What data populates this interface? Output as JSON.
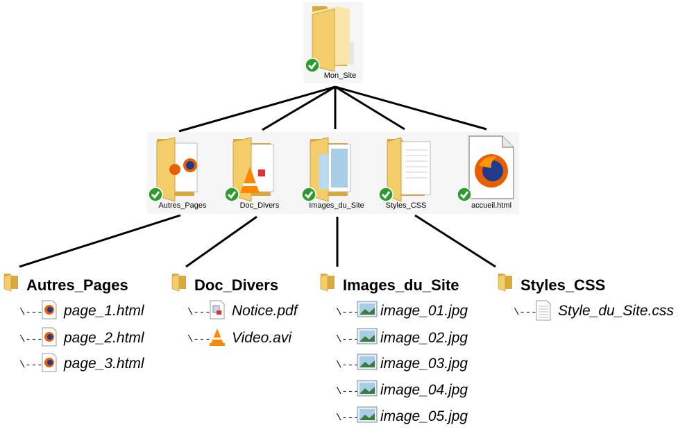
{
  "colors": {
    "folder": "#f2cd6a",
    "folder_dark": "#d9a93b",
    "check": "#2e9b2e",
    "line": "#000000",
    "tile_bg": "#f5f5f5"
  },
  "root": {
    "label": "Mon_Site",
    "icon": "folder-icon",
    "synced": true
  },
  "children": [
    {
      "label": "Autres_Pages",
      "icon": "folder-icon",
      "synced": true
    },
    {
      "label": "Doc_Divers",
      "icon": "folder-icon",
      "synced": true
    },
    {
      "label": "Images_du_Site",
      "icon": "folder-icon",
      "synced": true
    },
    {
      "label": "Styles_CSS",
      "icon": "folder-icon",
      "synced": true
    },
    {
      "label": "accueil.html",
      "icon": "firefox-file-icon",
      "synced": true
    }
  ],
  "listings": [
    {
      "title": "Autres_Pages",
      "files": [
        {
          "name": "page_1.html",
          "icon": "firefox-file-icon"
        },
        {
          "name": "page_2.html",
          "icon": "firefox-file-icon"
        },
        {
          "name": "page_3.html",
          "icon": "firefox-file-icon"
        }
      ]
    },
    {
      "title": "Doc_Divers",
      "files": [
        {
          "name": "Notice.pdf",
          "icon": "pdf-file-icon"
        },
        {
          "name": "Video.avi",
          "icon": "vlc-cone-icon"
        }
      ]
    },
    {
      "title": "Images_du_Site",
      "files": [
        {
          "name": "image_01.jpg",
          "icon": "image-file-icon"
        },
        {
          "name": "image_02.jpg",
          "icon": "image-file-icon"
        },
        {
          "name": "image_03.jpg",
          "icon": "image-file-icon"
        },
        {
          "name": "image_04.jpg",
          "icon": "image-file-icon"
        },
        {
          "name": "image_05.jpg",
          "icon": "image-file-icon"
        }
      ]
    },
    {
      "title": "Styles_CSS",
      "files": [
        {
          "name": "Style_du_Site.css",
          "icon": "text-file-icon"
        }
      ]
    }
  ],
  "branch_glyph": "\\---"
}
